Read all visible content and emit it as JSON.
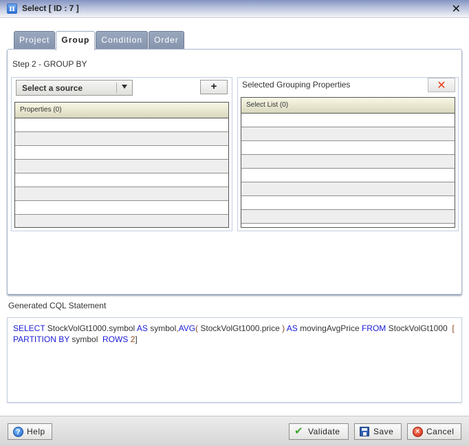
{
  "window": {
    "title": "Select [ ID : 7 ]",
    "app_icon": "pi-icon",
    "close_glyph": "✕"
  },
  "tabs": [
    {
      "label": "Project",
      "active": false
    },
    {
      "label": "Group",
      "active": true
    },
    {
      "label": "Condition",
      "active": false
    },
    {
      "label": "Order",
      "active": false
    }
  ],
  "step": {
    "label": "Step 2 - GROUP BY"
  },
  "source_panel": {
    "select_label": "Select a source",
    "add_label": "+",
    "grid_header": "Properties (0)",
    "rows": [
      "",
      "",
      "",
      "",
      "",
      "",
      "",
      ""
    ]
  },
  "selected_panel": {
    "title": "Selected Grouping Properties",
    "remove_glyph": "✕",
    "grid_header": "Select List (0)",
    "rows": [
      "",
      "",
      "",
      "",
      "",
      "",
      "",
      "",
      ""
    ]
  },
  "cql": {
    "label": "Generated CQL Statement",
    "tokens": [
      {
        "t": "SELECT",
        "k": "kw"
      },
      {
        "t": " StockVolGt1000.symbol ",
        "k": ""
      },
      {
        "t": "AS",
        "k": "kw"
      },
      {
        "t": " symbol",
        "k": ""
      },
      {
        "t": ",",
        "k": "br"
      },
      {
        "t": "AVG",
        "k": "kw"
      },
      {
        "t": "(",
        "k": "br"
      },
      {
        "t": " StockVolGt1000.price ",
        "k": ""
      },
      {
        "t": ")",
        "k": "br"
      },
      {
        "t": " ",
        "k": ""
      },
      {
        "t": "AS",
        "k": "kw"
      },
      {
        "t": " movingAvgPrice ",
        "k": ""
      },
      {
        "t": "FROM",
        "k": "kw"
      },
      {
        "t": " StockVolGt1000  ",
        "k": ""
      },
      {
        "t": "[",
        "k": "br"
      },
      {
        "t": " ",
        "k": ""
      },
      {
        "t": "PARTITION BY",
        "k": "kw"
      },
      {
        "t": " symbol  ",
        "k": ""
      },
      {
        "t": "ROWS",
        "k": "kw"
      },
      {
        "t": " ",
        "k": ""
      },
      {
        "t": "2",
        "k": "br"
      },
      {
        "t": "]",
        "k": ""
      }
    ]
  },
  "footer": {
    "help_label": "Help",
    "validate_label": "Validate",
    "save_label": "Save",
    "cancel_label": "Cancel"
  },
  "colors": {
    "keyword": "#1a1ad8",
    "bracket": "#8b4a1a",
    "tab_inactive": "#8594ad",
    "grid_header": "#d9d7bd"
  }
}
